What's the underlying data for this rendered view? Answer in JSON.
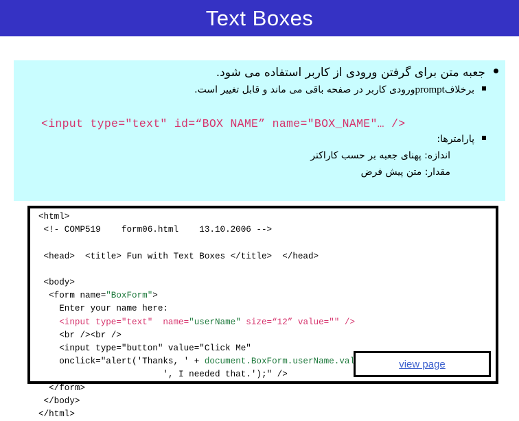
{
  "slide": {
    "title": "Text Boxes",
    "title_bar_color": "#3532c4",
    "panel_color": "#c9fdff"
  },
  "content": {
    "line1": "جعبه متن برای گرفتن ورودی از کاربر استفاده می شود.",
    "line2_before": "برخلاف",
    "line2_latin": "prompt",
    "line2_after": "ورودی کاربر در صفحه باقی می ماند و قابل تغییر است.",
    "code_inline": "<input type=\"text\" id=“BOX NAME” name=\"BOX_NAME\"… />",
    "params_label": "پارامترها:",
    "size_line": "اندازه: پهنای جعبه بر حسب کاراکتر",
    "value_line": "مقدار: متن پیش فرض"
  },
  "code_block": {
    "lines": [
      "<html>",
      " <!- COMP519    form06.html    13.10.2006 -->",
      "",
      " <head>  <title> Fun with Text Boxes </title>  </head>",
      "",
      " <body>",
      "  <form name=\"BoxForm\">",
      "    Enter your name here:",
      "    <input type=\"text\"  name=\"userName\" size=“12” value=\"\" />",
      "    <br /><br />",
      "    <input type=\"button\" value=\"Click Me\"",
      "    onclick=\"alert('Thanks, ' + document.BoxForm.userName.value +",
      "                        ', I needed that.');\" />",
      "  </form>",
      " </body>",
      "</html>"
    ]
  },
  "view_page": {
    "label": "view page",
    "link_color": "#3a5fcd"
  }
}
